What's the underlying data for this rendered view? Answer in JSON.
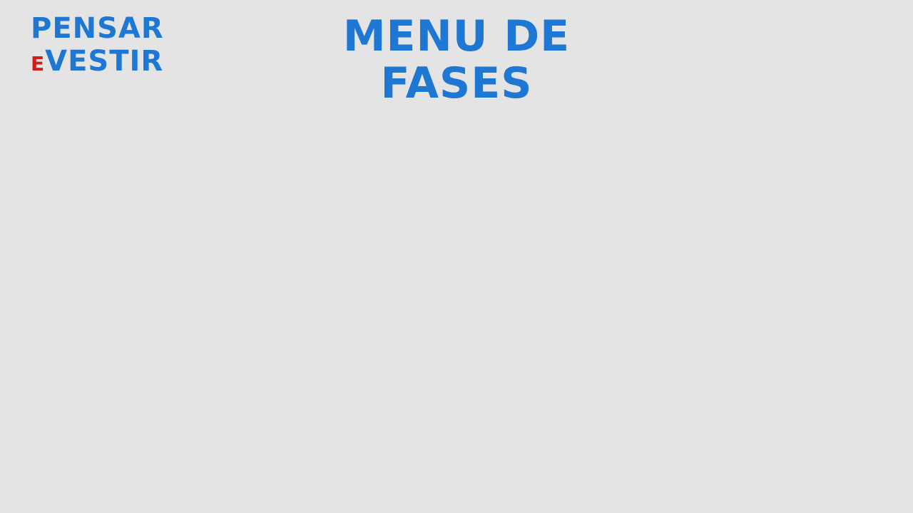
{
  "logo": {
    "line1": "PENSAR",
    "connector": "E",
    "line2": "VESTIR",
    "colors": {
      "primary": "#1f77d4",
      "accent": "#d21d1d"
    }
  },
  "title": {
    "line1": "MENU DE",
    "line2": "FASES",
    "color": "#1f77d4"
  },
  "background": "#e4e4e4"
}
